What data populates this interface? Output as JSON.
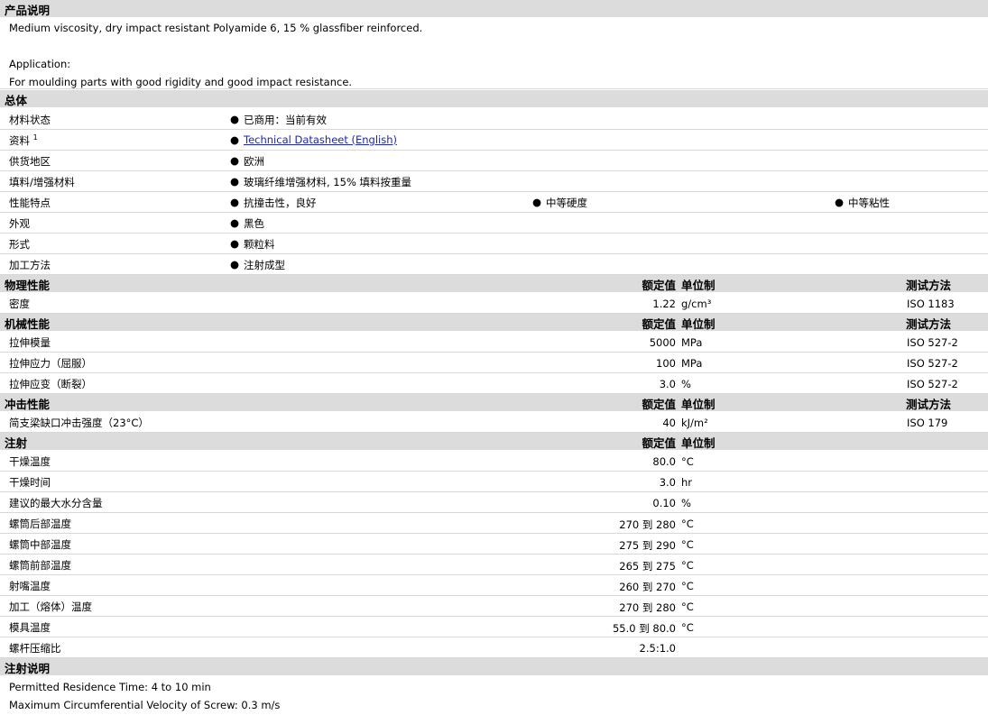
{
  "desc": {
    "header": "产品说明",
    "line1": "Medium viscosity, dry impact resistant Polyamide 6, 15 % glassfiber reinforced.",
    "line2": "Application:",
    "line3": "For moulding parts with good rigidity and good impact resistance."
  },
  "overview": {
    "header": "总体",
    "rows": [
      {
        "label": "材料状态",
        "items": [
          "已商用：当前有效"
        ]
      },
      {
        "label": "资料",
        "sup": "1",
        "items": [
          "Technical Datasheet (English)"
        ]
      },
      {
        "label": "供货地区",
        "items": [
          "欧洲"
        ]
      },
      {
        "label": "填料/增强材料",
        "items": [
          "玻璃纤维增强材料, 15% 填料按重量"
        ]
      },
      {
        "label": "性能特点",
        "items": [
          "抗撞击性，良好",
          "中等硬度",
          "中等粘性"
        ]
      },
      {
        "label": "外观",
        "items": [
          "黑色"
        ]
      },
      {
        "label": "形式",
        "items": [
          "颗粒料"
        ]
      },
      {
        "label": "加工方法",
        "items": [
          "注射成型"
        ]
      }
    ]
  },
  "col": {
    "nominal": "额定值",
    "unit": "单位制",
    "test": "测试方法"
  },
  "physical": {
    "header": "物理性能",
    "rows": [
      {
        "label": "密度",
        "value": "1.22",
        "unit": "g/cm³",
        "test": "ISO 1183"
      }
    ]
  },
  "mechanical": {
    "header": "机械性能",
    "rows": [
      {
        "label": "拉伸模量",
        "value": "5000",
        "unit": "MPa",
        "test": "ISO 527-2"
      },
      {
        "label": "拉伸应力（屈服）",
        "value": "100",
        "unit": "MPa",
        "test": "ISO 527-2"
      },
      {
        "label": "拉伸应变（断裂）",
        "value": "3.0",
        "unit": "%",
        "test": "ISO 527-2"
      }
    ]
  },
  "impact": {
    "header": "冲击性能",
    "rows": [
      {
        "label": "简支梁缺口冲击强度（23°C）",
        "value": "40",
        "unit": "kJ/m²",
        "test": "ISO 179"
      }
    ]
  },
  "injection": {
    "header": "注射",
    "rows": [
      {
        "label": "干燥温度",
        "value": "80.0",
        "unit": "°C"
      },
      {
        "label": "干燥时间",
        "value": "3.0",
        "unit": "hr"
      },
      {
        "label": "建议的最大水分含量",
        "value": "0.10",
        "unit": "%"
      },
      {
        "label": "螺筒后部温度",
        "value": "270 到  280",
        "unit": "°C"
      },
      {
        "label": "螺筒中部温度",
        "value": "275 到  290",
        "unit": "°C"
      },
      {
        "label": "螺筒前部温度",
        "value": "265 到  275",
        "unit": "°C"
      },
      {
        "label": "射嘴温度",
        "value": "260 到  270",
        "unit": "°C"
      },
      {
        "label": "加工（熔体）温度",
        "value": "270 到  280",
        "unit": "°C"
      },
      {
        "label": "模具温度",
        "value": "55.0 到  80.0",
        "unit": "°C"
      },
      {
        "label": "螺杆压缩比",
        "value": "2.5:1.0",
        "unit": ""
      }
    ]
  },
  "notes": {
    "header": "注射说明",
    "line1": "Permitted Residence Time: 4 to 10 min",
    "line2": "Maximum Circumferential Velocity of Screw: 0.3 m/s"
  }
}
